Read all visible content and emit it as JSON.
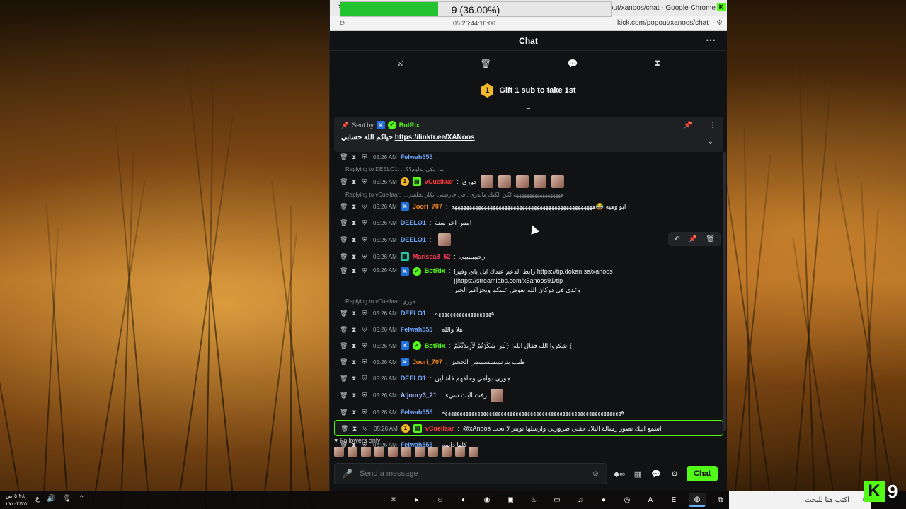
{
  "browser": {
    "title": "n/popout/xanoos/chat - Google Chrome",
    "url": "kick.com/popout/xanoos/chat"
  },
  "progress": {
    "label": "9 (36.00%)",
    "percent": 36,
    "sub": "05:26:44:10:00"
  },
  "chat": {
    "header": "Chat",
    "gift_text": "Gift 1 sub to take 1st",
    "gift_count": "1",
    "pinned": {
      "sent_by": "Sent by",
      "user": "BotRix",
      "message_prefix": "حياكم الله حسابي",
      "link": "https://linktr.ee/XANoos"
    },
    "messages": [
      {
        "time": "05:26 AM",
        "user": "Felwah555",
        "color": "#6fa8ff",
        "text": "",
        "reply": ""
      },
      {
        "time": "05:26 AM",
        "user": "vCuellaar",
        "color": "#ff3b3b",
        "text": "جوري",
        "reply": "Replying to DEELO1: ...من بكى يداوم؟؟",
        "emotes": 5,
        "badges": [
          "sub",
          "green"
        ]
      },
      {
        "time": "05:26 AM",
        "user": "Joori_707",
        "color": "#ff8c1a",
        "text": "ابو وهيه 😂ههههههههههههههههههههههههههههههههههههههههههههههههه",
        "reply": "Replying to vCuellaar: ...ههههههههههههههههههه لكن الكبك مايدري ..في خارطتي انكار تخلفني",
        "badges": [
          "mod"
        ]
      },
      {
        "time": "05:26 AM",
        "user": "DEELO1",
        "color": "#6fa8ff",
        "text": "امس اخر سنة",
        "reply": ""
      },
      {
        "time": "05:26 AM",
        "user": "DEELO1",
        "color": "#6fa8ff",
        "text": "",
        "reply": "",
        "emotes": 1
      },
      {
        "time": "05:26 AM",
        "user": "Marissa8_52",
        "color": "#ff3b5c",
        "text": "ارحبببببببي",
        "reply": "",
        "badges": [
          "teal"
        ]
      },
      {
        "time": "05:26 AM",
        "user": "BotRix",
        "color": "#53fc18",
        "text": "رابط الدعم عندك ابل باي وفيزا https://tip.dokan.sa/xanoos ||https://streamlabs.com/x5anoos91/tip",
        "text2": "وعدي في دوكان الله يعوض عليكم ويجزاكم الخير",
        "reply": "",
        "badges": [
          "mod",
          "ver"
        ]
      },
      {
        "time": "05:26 AM",
        "user": "DEELO1",
        "color": "#6fa8ff",
        "text": "هههههههههههههههههههه",
        "reply": "Replying to vCuellaar: جوري",
        "emotes": 0
      },
      {
        "time": "05:26 AM",
        "user": "Felwah555",
        "color": "#6fa8ff",
        "text": "هلا والله",
        "reply": ""
      },
      {
        "time": "05:26 AM",
        "user": "BotRix",
        "color": "#53fc18",
        "text": "اشكروا الله فقال الله: ﴿لَئِن شَكَرْتُمْ لَأَزِيدَنَّكُمْ﴾",
        "reply": "",
        "badges": [
          "mod",
          "ver"
        ]
      },
      {
        "time": "05:26 AM",
        "user": "Joori_707",
        "color": "#ff8c1a",
        "text": "طيب بترنسسسسس الحجيز",
        "reply": "",
        "badges": [
          "mod"
        ]
      },
      {
        "time": "05:26 AM",
        "user": "DEELO1",
        "color": "#6fa8ff",
        "text": "جوري دوامي وحلفهم فاشلين",
        "reply": ""
      },
      {
        "time": "05:26 AM",
        "user": "Aljoury3_21",
        "color": "#9fb6ff",
        "text": "رفت البث سيء",
        "reply": "",
        "emotes": 1
      },
      {
        "time": "05:26 AM",
        "user": "Felwah555",
        "color": "#6fa8ff",
        "text": "هههههههههههههههههههههههههههههههههههههههههههههههههههههههههههههه",
        "reply": ""
      },
      {
        "time": "05:26 AM",
        "user": "vCuellaar",
        "color": "#ff3b3b",
        "text": "@xAnoos اسمع ابيك تصور رسالة البلاد حقتي ضروريي وارسلها تويتر لا تحت",
        "reply": "",
        "badges": [
          "sub",
          "green"
        ],
        "highlight": true
      },
      {
        "time": "05:26 AM",
        "user": "Felwah555",
        "color": "#6fa8ff",
        "text": "كلها دايمه",
        "reply": ""
      }
    ],
    "followers_only": "Followers only",
    "input_placeholder": "Send a message",
    "send_label": "Chat"
  },
  "taskbar": {
    "clock": "٥:٢٨ ص",
    "date": "٢٧/٠٣/٢٥",
    "lang": "ع",
    "search_placeholder": "اكتب هنا للبحث",
    "apps": [
      "mail",
      "terminal",
      "smile",
      "edge",
      "obs",
      "news",
      "steam",
      "folder",
      "spotify",
      "record",
      "discord",
      "adobe",
      "epic",
      "chrome",
      "taskview"
    ]
  },
  "overlay": {
    "kick_letter": "K",
    "viewer_count": "9"
  },
  "colors": {
    "kick_green": "#53fc18",
    "chat_bg": "#111214",
    "progress_green": "#22c32e"
  }
}
